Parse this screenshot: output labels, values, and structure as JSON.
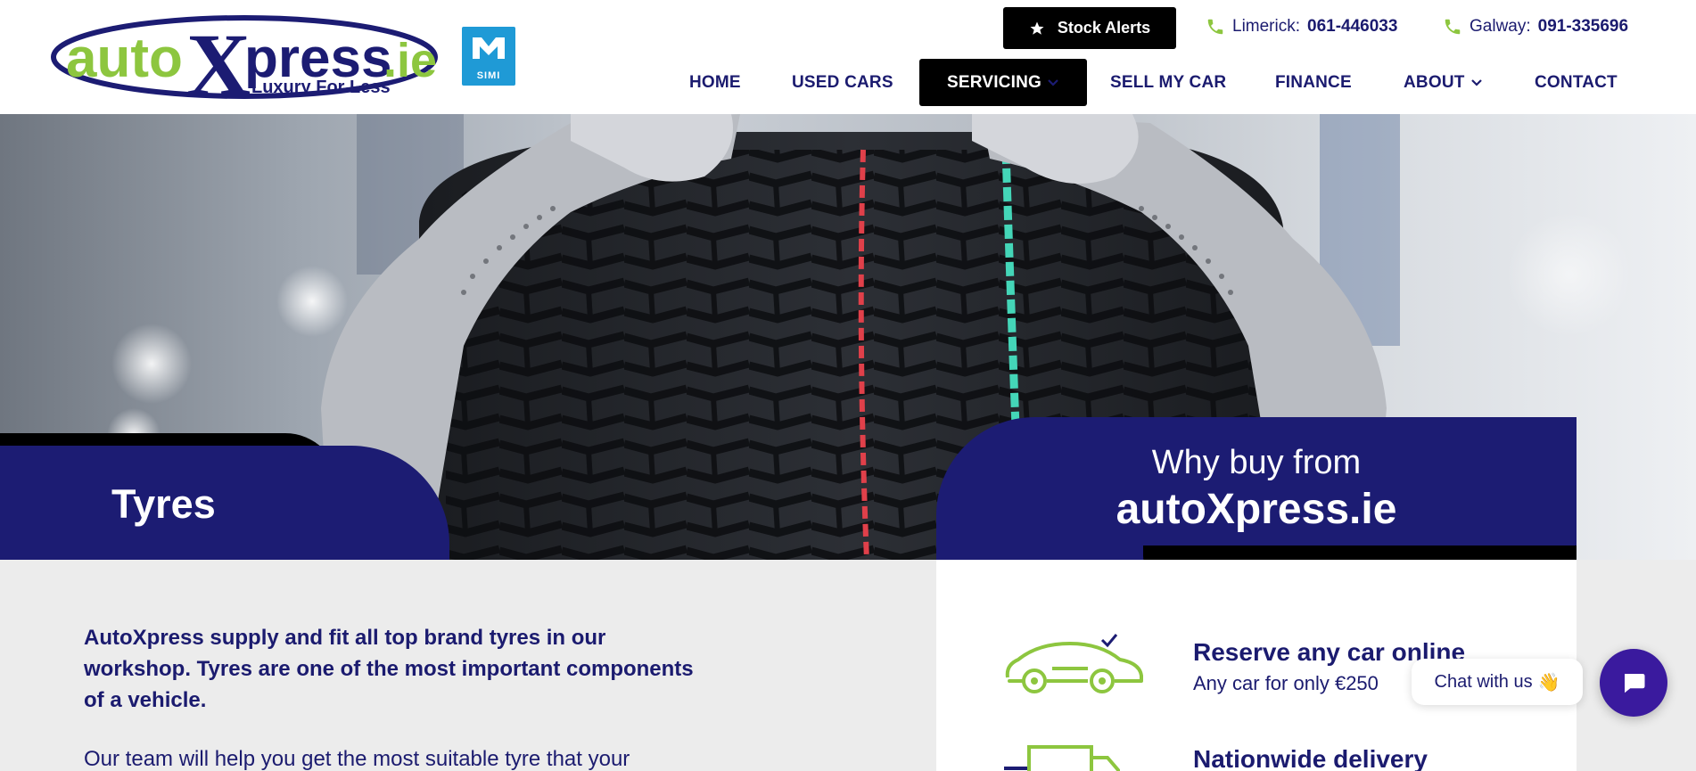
{
  "header": {
    "logo": {
      "text_auto": "auto",
      "text_x": "X",
      "text_press": "press",
      "text_ie": ".ie",
      "tagline": "Luxury For Less"
    },
    "simi_badge": {
      "label": "SIMI"
    },
    "stock_alerts_label": "Stock Alerts",
    "phones": [
      {
        "label": "Limerick:",
        "number": "061-446033"
      },
      {
        "label": "Galway:",
        "number": "091-335696"
      }
    ],
    "nav": [
      {
        "label": "HOME"
      },
      {
        "label": "USED CARS"
      },
      {
        "label": "SERVICING",
        "active": true,
        "has_dropdown": true
      },
      {
        "label": "SELL MY CAR"
      },
      {
        "label": "FINANCE"
      },
      {
        "label": "ABOUT",
        "has_dropdown": true
      },
      {
        "label": "CONTACT"
      }
    ]
  },
  "hero": {
    "page_title": "Tyres",
    "why_line1": "Why buy from",
    "why_line2": "autoXpress.ie"
  },
  "content": {
    "intro": "AutoXpress supply and fit all top brand tyres in our workshop. Tyres are one of the most important components of a vehicle.",
    "body": "Our team will help you get the most suitable tyre that your"
  },
  "features": [
    {
      "icon": "car-check-icon",
      "title": "Reserve any car online",
      "subtitle": "Any car for only €250"
    },
    {
      "icon": "delivery-truck-icon",
      "title": "Nationwide delivery",
      "subtitle": ""
    }
  ],
  "chat": {
    "bubble_text": "Chat with us",
    "wave": "👋"
  },
  "colors": {
    "navy": "#1c1c73",
    "green": "#8dc63f",
    "black": "#000000",
    "chat_purple": "#3a1a9e",
    "simi_blue": "#1f9ad6"
  }
}
